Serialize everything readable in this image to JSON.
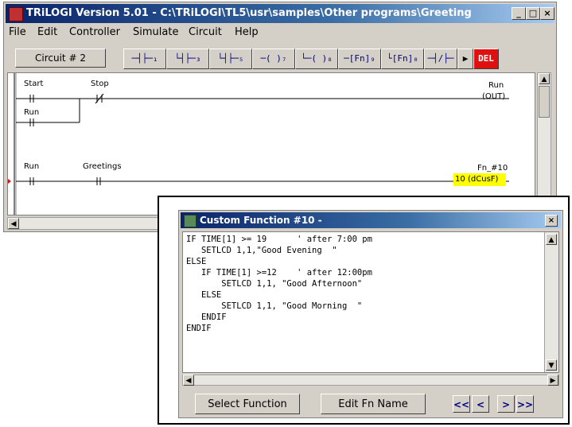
{
  "main_window": {
    "title": "TRiLOGI Version 5.01 - C:\\TRiLOGI\\TL5\\usr\\samples\\Other programs\\Greeting",
    "menu": [
      "File",
      "Edit",
      "Controller",
      "Simulate",
      "Circuit",
      "Help"
    ],
    "circuit_label": "Circuit # 2",
    "tools": [
      "─┤├─₁",
      "└┤├─₃",
      "└┤├─₅",
      "─( )₇",
      "└─( )₈",
      "─[Fn]₉",
      "└[Fn]₀",
      "─┤/├─",
      "▶",
      "DEL"
    ],
    "window_buttons": [
      "_",
      "□",
      "×"
    ]
  },
  "ladder": {
    "rung1": {
      "contact1": "Start",
      "contact2": "Stop",
      "branch": "Run",
      "coil_name": "Run",
      "coil_type": "(OUT)"
    },
    "rung2": {
      "contact1": "Run",
      "contact2": "Greetings",
      "fn_name": "Fn_#10",
      "fn_num": "10",
      "fn_type": "(dCusF)"
    }
  },
  "dialog": {
    "title": "Custom Function #10 -",
    "code": "IF TIME[1] >= 19      ' after 7:00 pm\n   SETLCD 1,1,\"Good Evening  \"\nELSE\n   IF TIME[1] >=12    ' after 12:00pm\n       SETLCD 1,1, \"Good Afternoon\"\n   ELSE\n       SETLCD 1,1, \"Good Morning  \"\n   ENDIF\nENDIF",
    "buttons": {
      "select_function": "Select Function",
      "edit_fn_name": "Edit Fn Name"
    },
    "nav": {
      "first": "<<",
      "prev": "<",
      "next": ">",
      "last": ">>"
    },
    "close": "×"
  },
  "colors": {
    "title_bar": "#0a246a",
    "highlight": "#ffff00",
    "del_button": "#e01010",
    "rung_marker": "#e01010"
  }
}
